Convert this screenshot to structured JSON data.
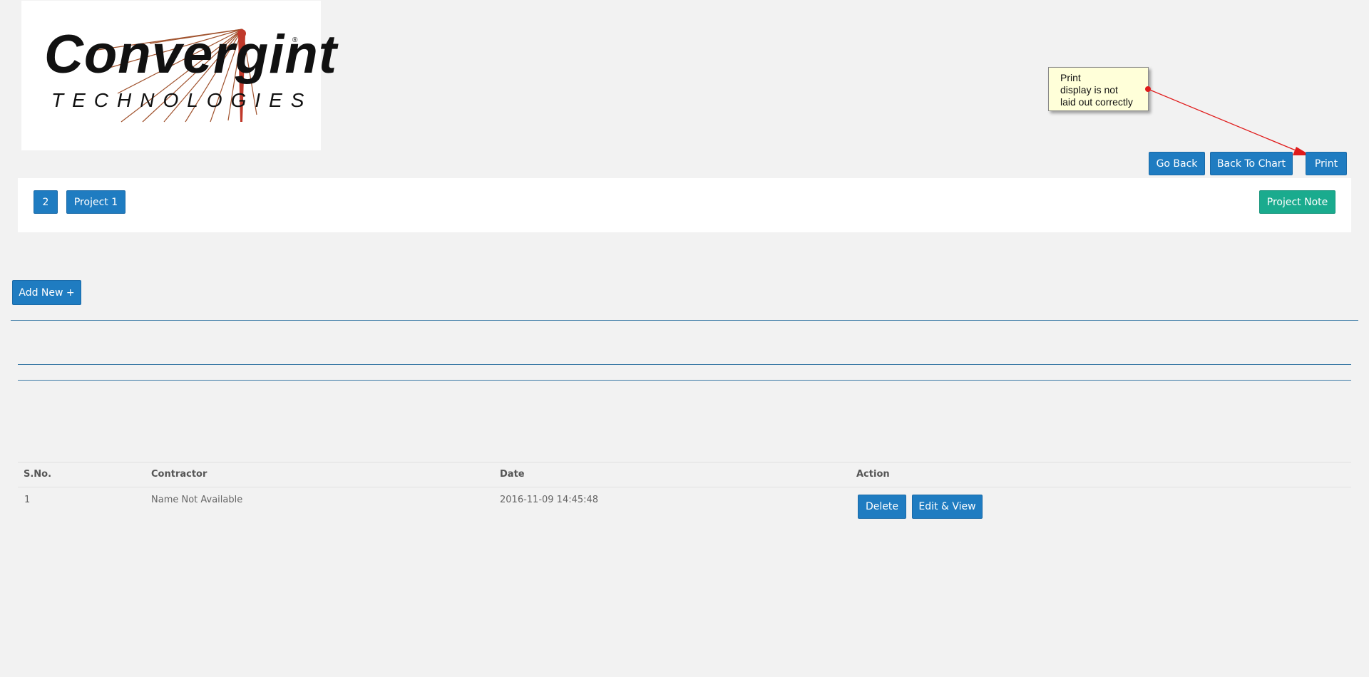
{
  "logo": {
    "word": "Convergint",
    "sub": "TECHNOLOGIES",
    "reg": "®"
  },
  "callout": {
    "lines": [
      "Print",
      "display is not",
      "laid out correctly"
    ]
  },
  "toolbar": {
    "go_back": "Go Back",
    "back_to_chart": "Back To Chart",
    "print": "Print"
  },
  "project_bar": {
    "number": "2",
    "project": "Project 1",
    "note": "Project Note"
  },
  "add_new": "Add New +",
  "table": {
    "headers": [
      "S.No.",
      "Contractor",
      "Date",
      "Action"
    ],
    "rows": [
      {
        "sno": "1",
        "contractor": "Name Not Available",
        "date": "2016-11-09 14:45:48",
        "delete": "Delete",
        "edit": "Edit & View"
      }
    ]
  },
  "colors": {
    "primary": "#1f7cc1",
    "teal": "#1aab8e",
    "background": "#f2f2f2",
    "callout_bg": "#ffffd9",
    "arrow": "#e01b1b"
  }
}
